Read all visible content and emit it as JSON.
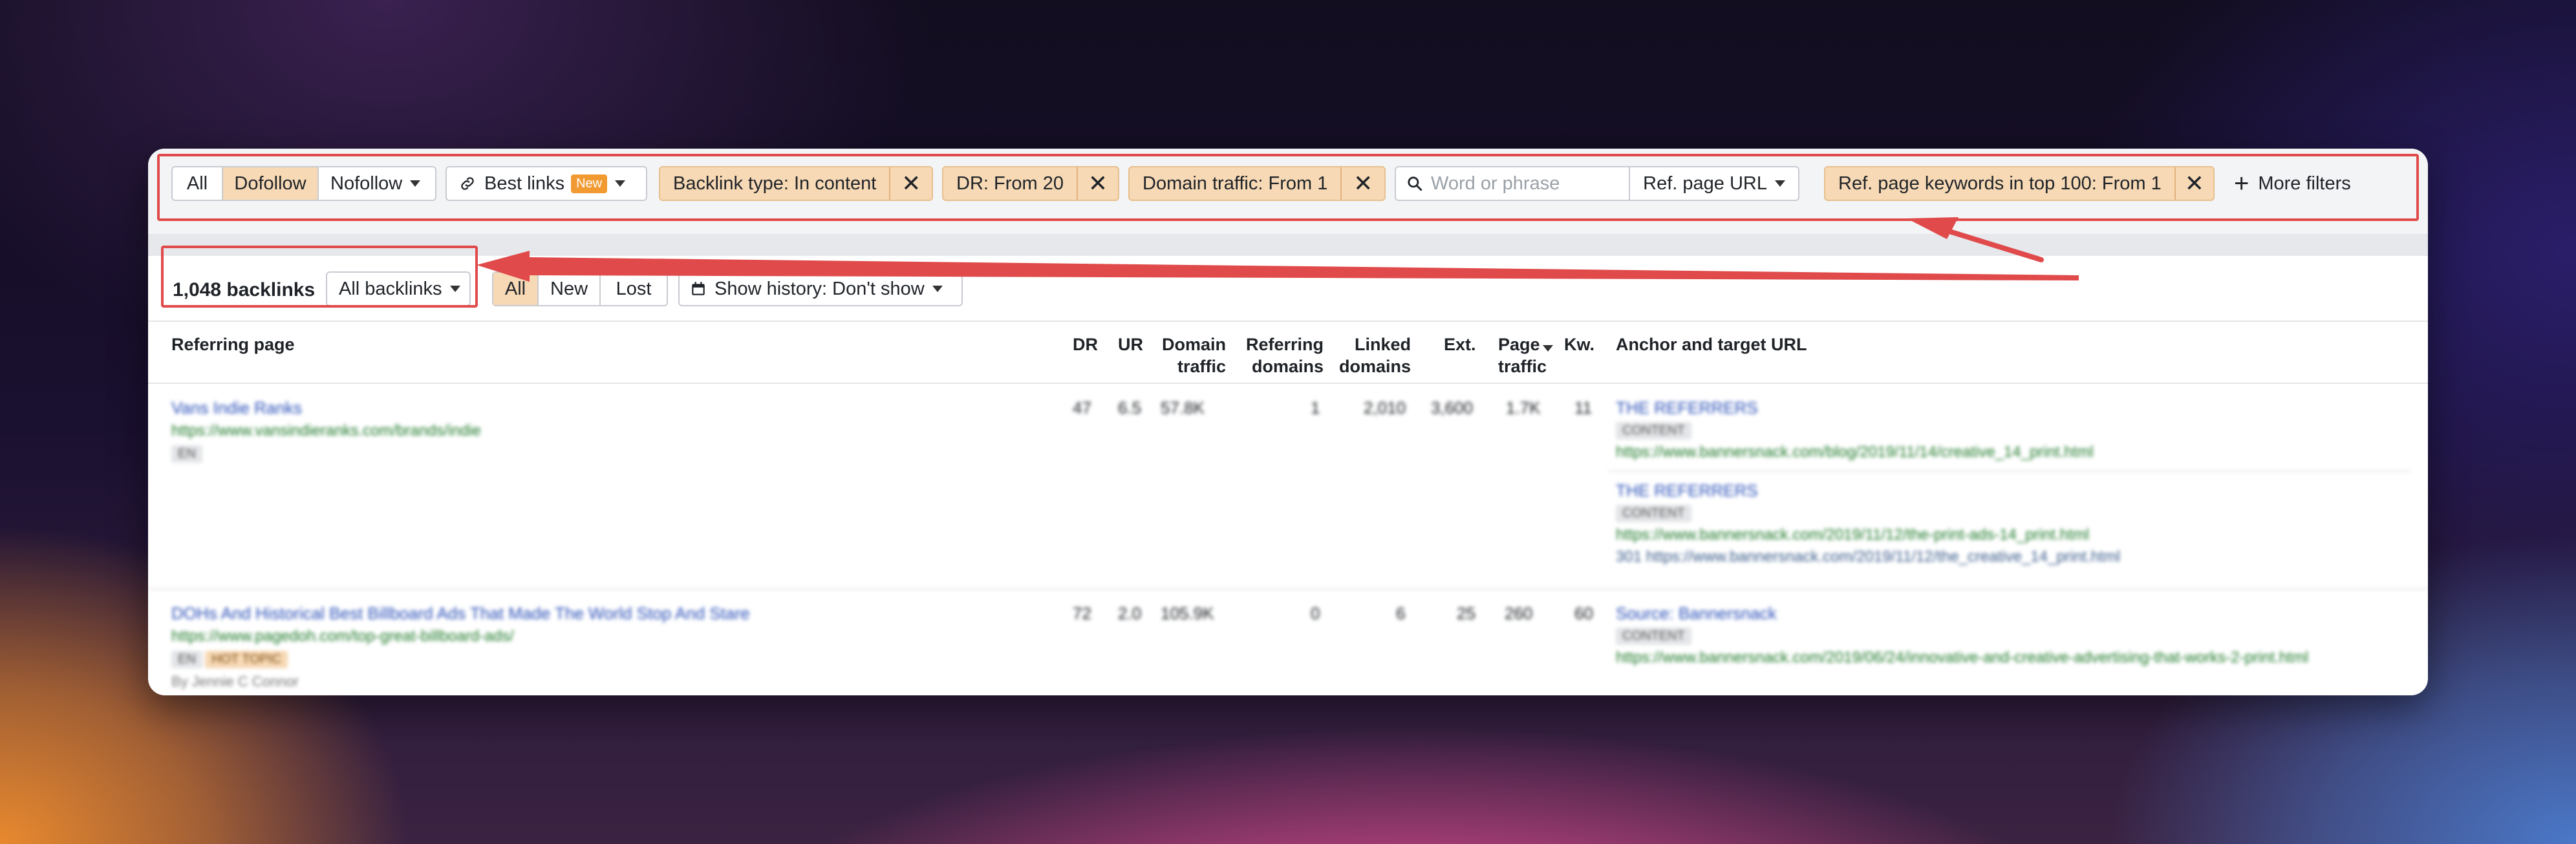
{
  "filters": {
    "type_segments": [
      {
        "label": "All",
        "active": false
      },
      {
        "label": "Dofollow",
        "active": true
      },
      {
        "label": "Nofollow",
        "active": false
      }
    ],
    "best_links": {
      "label": "Best links",
      "badge": "New"
    },
    "backlink_type": "Backlink type: In content",
    "dr": "DR: From 20",
    "domain_traffic": "Domain traffic: From 1",
    "search_placeholder": "Word or phrase",
    "search_scope": "Ref. page URL",
    "ref_keywords": "Ref. page keywords in top 100: From 1",
    "more_filters": "More filters"
  },
  "toolbar": {
    "count": "1,048 backlinks",
    "group_select": "All backlinks",
    "tabs": [
      "All",
      "New",
      "Lost"
    ],
    "history": "Show history: Don't show"
  },
  "columns": {
    "referring_page": "Referring page",
    "dr": "DR",
    "ur": "UR",
    "domain_traffic_l1": "Domain",
    "domain_traffic_l2": "traffic",
    "referring_domains_l1": "Referring",
    "referring_domains_l2": "domains",
    "linked_domains_l1": "Linked",
    "linked_domains_l2": "domains",
    "ext": "Ext.",
    "page_traffic_l1": "Page",
    "page_traffic_l2": "traffic",
    "kw": "Kw.",
    "anchor": "Anchor and target URL"
  },
  "rows": [
    {
      "title": "Vans Indie Ranks",
      "url": "https://www.vansindieranks.com/brands/indie",
      "tags": [
        "EN"
      ],
      "dr": "47",
      "ur": "6.5",
      "domain_traffic": "57.8K",
      "ref_domains": "1",
      "linked_domains": "2,010",
      "ext": "3,600",
      "page_traffic": "1.7K",
      "kw": "11",
      "anchors": [
        {
          "text": "THE REFERRERS",
          "tag": "CONTENT",
          "target": "https://www.bannersnack.com/blog/2019/11/14/creative_14_print.html"
        },
        {
          "text": "THE REFERRERS",
          "tag": "CONTENT",
          "target": "https://www.bannersnack.com/2019/11/12/the-print-ads-14_print.html",
          "target2": "301 https://www.bannersnack.com/2019/11/12/the_creative_14_print.html"
        }
      ]
    },
    {
      "title": "DOHs And Historical Best Billboard Ads That Made The World Stop And Stare",
      "url": "https://www.pagedoh.com/top-great-billboard-ads/",
      "tags": [
        "EN",
        "HOT TOPIC"
      ],
      "author": "By Jennie C Connor",
      "dr": "72",
      "ur": "2.0",
      "domain_traffic": "105.9K",
      "ref_domains": "0",
      "linked_domains": "6",
      "ext": "25",
      "page_traffic": "260",
      "kw": "60",
      "anchors": [
        {
          "text": "Source: Bannersnack",
          "tag": "CONTENT",
          "target": "https://www.bannersnack.com/2019/06/24/innovative-and-creative-advertising-that-works-2-print.html"
        }
      ]
    }
  ],
  "colors": {
    "accent_orange": "#f7d9b5",
    "annotation_red": "#e04a4a",
    "link_blue": "#2a4fb8",
    "url_green": "#1f7a2a"
  }
}
